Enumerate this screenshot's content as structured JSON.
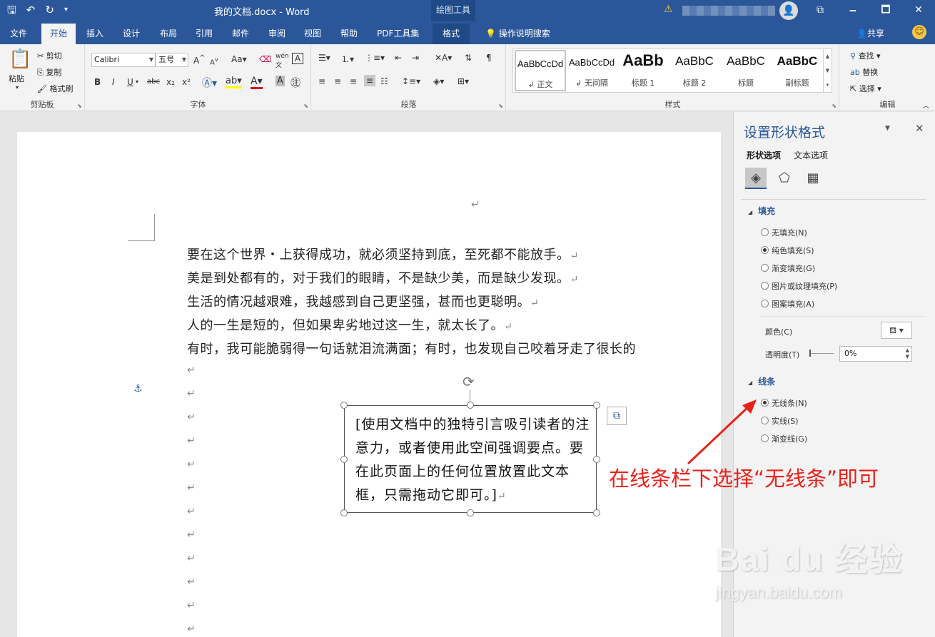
{
  "window": {
    "doc_title": "我的文档.docx  -  Word",
    "contextual_tab_group": "绘图工具",
    "controls": [
      "🗕",
      "🗖",
      "✕"
    ],
    "restore_icon": "⧉"
  },
  "tabs": [
    "文件",
    "开始",
    "插入",
    "设计",
    "布局",
    "引用",
    "邮件",
    "审阅",
    "视图",
    "帮助",
    "PDF工具集",
    "格式"
  ],
  "active_tab": "开始",
  "tell_me": "操作说明搜索",
  "share": "共享",
  "ribbon": {
    "clipboard": {
      "label": "剪贴板",
      "paste": "粘贴",
      "cut": "剪切",
      "copy": "复制",
      "format_painter": "格式刷"
    },
    "font": {
      "label": "字体",
      "font_name": "Calibri",
      "font_size": "五号",
      "bold": "B",
      "italic": "I",
      "underline": "U",
      "strike": "abc",
      "sub": "x₂",
      "sup": "x²"
    },
    "paragraph": {
      "label": "段落"
    },
    "styles": {
      "label": "样式",
      "items": [
        {
          "sample": "AaBbCcDd",
          "name": "↲ 正文"
        },
        {
          "sample": "AaBbCcDd",
          "name": "↲ 无间隔"
        },
        {
          "sample": "AaBb",
          "name": "标题 1"
        },
        {
          "sample": "AaBbC",
          "name": "标题 2"
        },
        {
          "sample": "AaBbC",
          "name": "标题"
        },
        {
          "sample": "AaBbC",
          "name": "副标题"
        }
      ]
    },
    "editing": {
      "label": "编辑",
      "find": "查找",
      "replace": "替换",
      "select": "选择"
    }
  },
  "document": {
    "pilcrow": "↵",
    "lines": [
      "要在这个世界・上获得成功，就必须坚持到底，至死都不能放手。",
      "美是到处都有的，对于我们的眼睛，不是缺少美，而是缺少发现。",
      "生活的情况越艰难，我越感到自己更坚强，甚而也更聪明。",
      "人的一生是短的，但如果卑劣地过这一生，就太长了。",
      "有时，我可能脆弱得一句话就泪流满面；有时，也发现自己咬着牙走了很长的"
    ],
    "textbox": "[使用文档中的独特引言吸引读者的注意力，或者使用此空间强调要点。要在此页面上的任何位置放置此文本框，只需拖动它即可。]"
  },
  "pane": {
    "title": "设置形状格式",
    "tabs": [
      "形状选项",
      "文本选项"
    ],
    "fill_section": "填充",
    "fill_options": [
      "无填充(N)",
      "纯色填充(S)",
      "渐变填充(G)",
      "图片或纹理填充(P)",
      "图案填充(A)"
    ],
    "fill_selected": 1,
    "color_label": "颜色(C)",
    "transparency_label": "透明度(T)",
    "transparency_value": "0%",
    "line_section": "线条",
    "line_options": [
      "无线条(N)",
      "实线(S)",
      "渐变线(G)"
    ],
    "line_selected": 0
  },
  "annotation": {
    "text": "在线条栏下选择“无线条”即可",
    "color": "#e8221a"
  },
  "watermark": {
    "main": "Bai du 经验",
    "sub": "jingyan.baidu.com"
  },
  "colors": {
    "word_blue": "#2b579a",
    "ribbon_bg": "#f3f3f3",
    "pane_bg": "#f3f3f3"
  }
}
